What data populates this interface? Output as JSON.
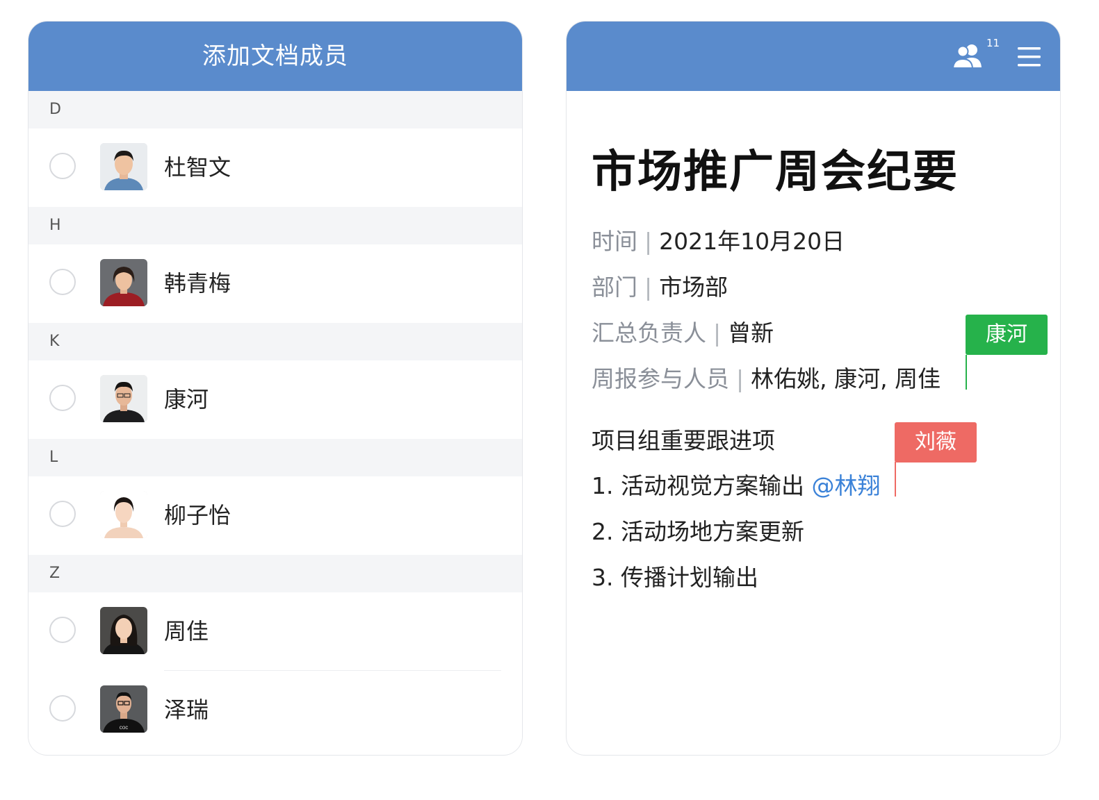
{
  "left_panel": {
    "title": "添加文档成员",
    "groups": [
      {
        "letter": "D",
        "members": [
          {
            "name": "杜智文"
          }
        ]
      },
      {
        "letter": "H",
        "members": [
          {
            "name": "韩青梅"
          }
        ]
      },
      {
        "letter": "K",
        "members": [
          {
            "name": "康河"
          }
        ]
      },
      {
        "letter": "L",
        "members": [
          {
            "name": "柳子怡"
          }
        ]
      },
      {
        "letter": "Z",
        "members": [
          {
            "name": "周佳"
          },
          {
            "name": "泽瑞"
          }
        ]
      }
    ]
  },
  "right_panel": {
    "header": {
      "members_count": "11",
      "members_icon": "people-icon",
      "menu_icon": "hamburger-menu-icon"
    },
    "doc": {
      "title": "市场推广周会纪要",
      "meta": [
        {
          "label": "时间",
          "sep": "|",
          "value": "2021年10月20日"
        },
        {
          "label": "部门",
          "sep": "|",
          "value": "市场部"
        },
        {
          "label": "汇总负责人",
          "sep": "|",
          "value": "曾新"
        },
        {
          "label": "周报参与人员",
          "sep": "|",
          "value": "林佑姚, 康河, 周佳"
        }
      ],
      "section_title": "项目组重要跟进项",
      "items": [
        {
          "text": "1. 活动视觉方案输出 ",
          "mention": "@林翔"
        },
        {
          "text": "2. 活动场地方案更新"
        },
        {
          "text": "3. 传播计划输出"
        }
      ]
    },
    "cursors": [
      {
        "name": "康河",
        "color": "#26b24b"
      },
      {
        "name": "刘薇",
        "color": "#ee6a64"
      }
    ]
  },
  "colors": {
    "header_blue": "#5a8bcc",
    "mention_blue": "#3b82d8",
    "group_bg": "#f4f5f7"
  }
}
